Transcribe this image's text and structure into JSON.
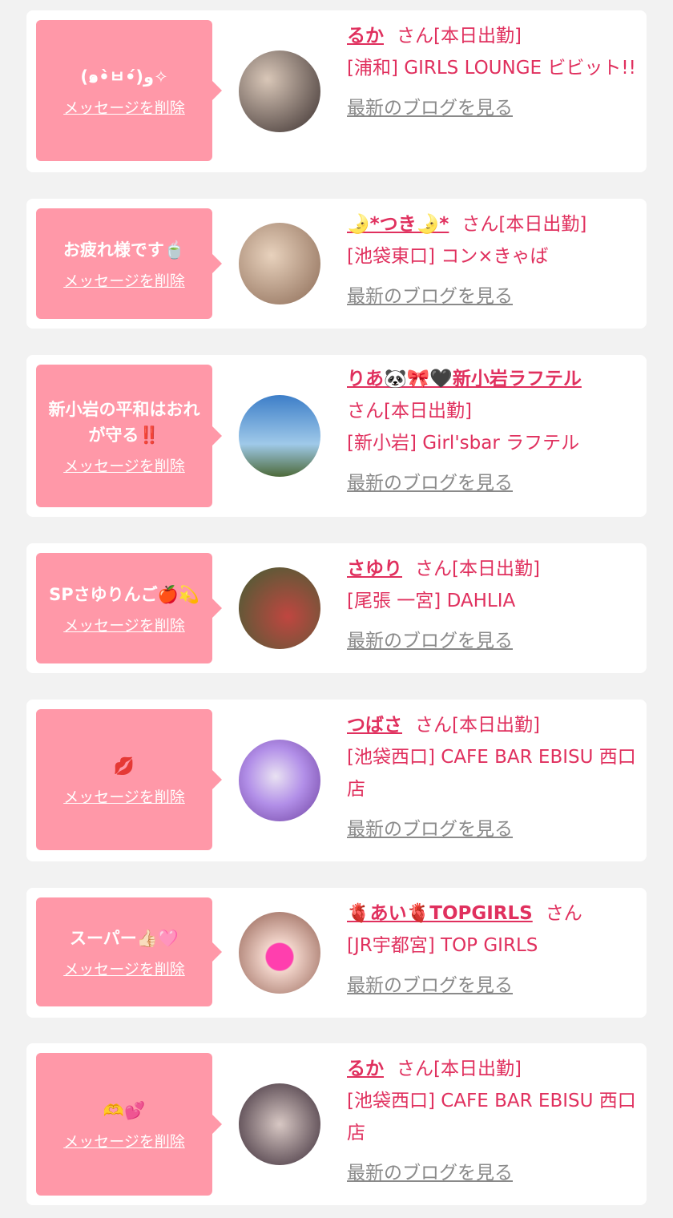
{
  "delete_label": "メッセージを削除",
  "blog_label": "最新のブログを見る",
  "san_label": "さん",
  "cards": [
    {
      "message": "(๑•̀ㅂ•́)و✧",
      "name": "るか",
      "status": "[本日出勤]",
      "shop": "[浦和] GIRLS LOUNGE ビビット!!",
      "avatar_colors": [
        "#d9c7b8",
        "#3a2f2e"
      ]
    },
    {
      "message": "お疲れ様です🍵",
      "name": "🌛*つき🌛*",
      "status": "[本日出勤]",
      "shop": "[池袋東口] コン×きゃば",
      "avatar_colors": [
        "#e8d2bd",
        "#8b6a55"
      ]
    },
    {
      "message": "新小岩の平和はおれが守る‼️",
      "name": "りあ🐼🎀🖤新小岩ラフテル",
      "status": "[本日出勤]",
      "shop": "[新小岩] Girl'sbar ラフテル",
      "avatar_colors": [
        "#3d7ec8",
        "#9fc9e9"
      ]
    },
    {
      "message": "SPさゆりんご🍎💫",
      "name": "さゆり",
      "status": "[本日出勤]",
      "shop": "[尾張 一宮] DAHLIA",
      "avatar_colors": [
        "#3f5f34",
        "#c04640"
      ]
    },
    {
      "message": "💋",
      "name": "つばさ",
      "status": "[本日出勤]",
      "shop": "[池袋西口] CAFE BAR EBISU 西口店",
      "avatar_colors": [
        "#b28fe8",
        "#6b3d9c"
      ]
    },
    {
      "message": "スーパー👍🏻🩷",
      "name": "🫀あい🫀TOPGIRLS",
      "status": "",
      "shop": "[JR宇都宮] TOP GIRLS",
      "avatar_colors": [
        "#f2d5cb",
        "#8d5a4c"
      ]
    },
    {
      "message": "🫶💕",
      "name": "るか",
      "status": "[本日出勤]",
      "shop": "[池袋西口] CAFE BAR EBISU 西口店",
      "avatar_colors": [
        "#3a2a36",
        "#d8c8c4"
      ]
    }
  ]
}
